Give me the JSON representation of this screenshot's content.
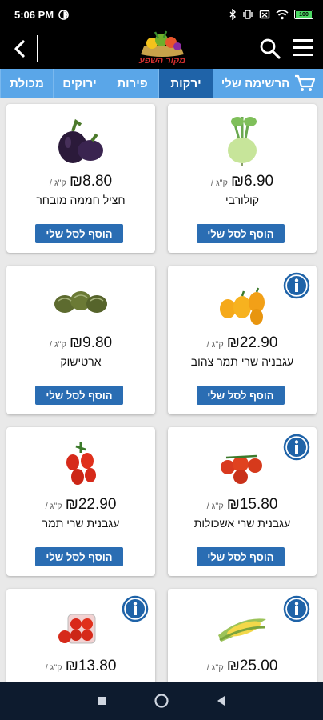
{
  "status_bar": {
    "time": "5:06 PM",
    "battery": "100"
  },
  "header": {
    "logo_text": "מקור השפע"
  },
  "tabs": [
    {
      "label": "מכולת",
      "active": false
    },
    {
      "label": "ירוקים",
      "active": false
    },
    {
      "label": "פירות",
      "active": false
    },
    {
      "label": "ירקות",
      "active": true
    },
    {
      "label": "הרשימה שלי",
      "active": false
    }
  ],
  "products": [
    {
      "name": "קולורבי",
      "price": "₪6.90",
      "unit": "ק\"ג /",
      "button": "הוסף לסל שלי",
      "info": false,
      "icon": "kohlrabi-image"
    },
    {
      "name": "חציל חממה מובחר",
      "price": "₪8.80",
      "unit": "ק\"ג /",
      "button": "הוסף לסל שלי",
      "info": false,
      "icon": "eggplant-image"
    },
    {
      "name": "עגבניה שרי תמר צהוב",
      "price": "₪22.90",
      "unit": "ק\"ג /",
      "button": "הוסף לסל שלי",
      "info": true,
      "icon": "yellow-tomato-image"
    },
    {
      "name": "ארטישוק",
      "price": "₪9.80",
      "unit": "ק\"ג /",
      "button": "הוסף לסל שלי",
      "info": false,
      "icon": "artichoke-image"
    },
    {
      "name": "עגבנית שרי אשכולות",
      "price": "₪15.80",
      "unit": "ק\"ג /",
      "button": "הוסף לסל שלי",
      "info": true,
      "icon": "cluster-tomato-image"
    },
    {
      "name": "עגבנית שרי תמר",
      "price": "₪22.90",
      "unit": "ק\"ג /",
      "button": "הוסף לסל שלי",
      "info": false,
      "icon": "cherry-tomato-image"
    },
    {
      "name": "",
      "price": "₪25.00",
      "unit": "ק\"ג /",
      "button": "",
      "info": true,
      "icon": "corn-image"
    },
    {
      "name": "",
      "price": "₪13.80",
      "unit": "ק\"ג /",
      "button": "",
      "info": true,
      "icon": "tomato-pack-image"
    }
  ],
  "colors": {
    "header_bg": "#000000",
    "tab_bg": "#5aa6e8",
    "tab_active": "#1f63a8",
    "button": "#2a6db3",
    "nav_bg": "#0d1b2e"
  }
}
